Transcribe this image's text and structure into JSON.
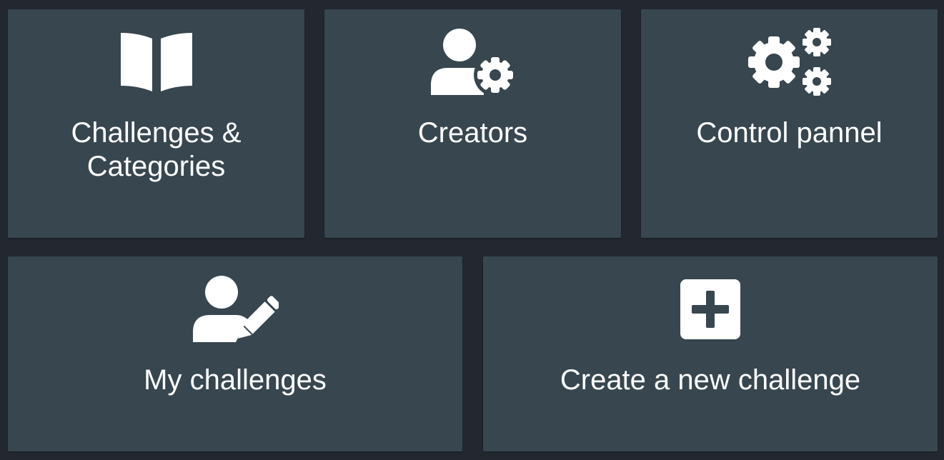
{
  "tiles": {
    "challenges": {
      "label": "Challenges &\nCategories",
      "icon": "book-open-icon"
    },
    "creators": {
      "label": "Creators",
      "icon": "user-gear-icon"
    },
    "control": {
      "label": "Control pannel",
      "icon": "gears-icon"
    },
    "my": {
      "label": "My challenges",
      "icon": "user-pen-icon"
    },
    "create": {
      "label": "Create a new challenge",
      "icon": "square-plus-icon"
    }
  },
  "colors": {
    "background": "#232830",
    "tile": "#37464f",
    "text": "#ffffff"
  }
}
